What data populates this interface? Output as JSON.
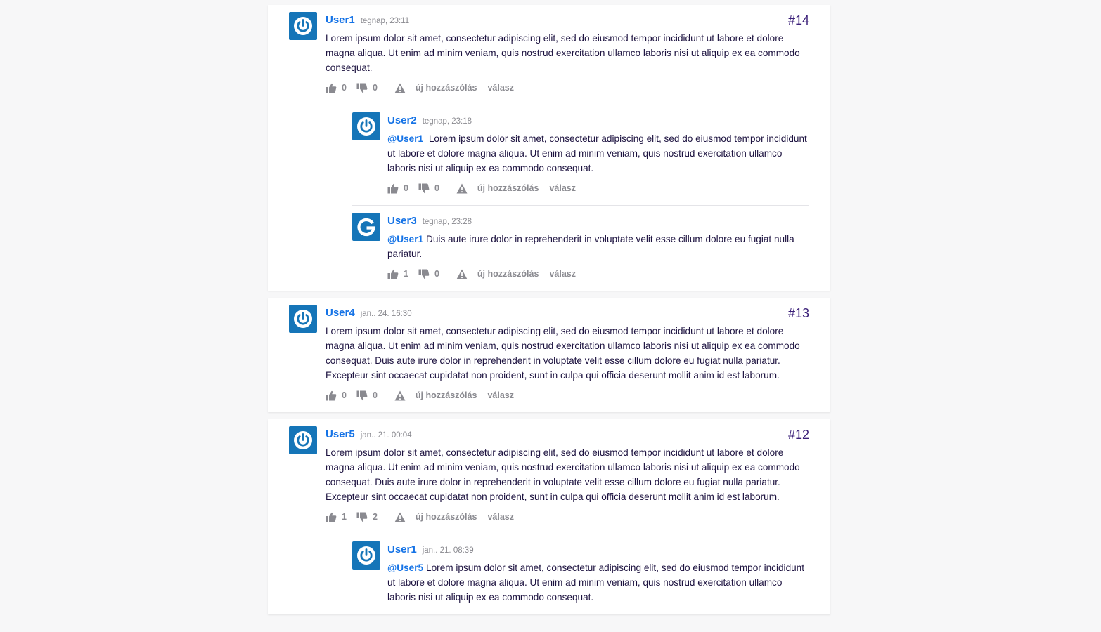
{
  "actions": {
    "new_post": "új hozzászólás",
    "reply": "válasz"
  },
  "threads": [
    {
      "number": "#14",
      "comment": {
        "user": "User1",
        "time": "tegnap, 23:11",
        "text": "Lorem ipsum dolor sit amet, consectetur adipiscing elit, sed do eiusmod tempor incididunt ut labore et dolore magna aliqua. Ut enim ad minim veniam, quis nostrud exercitation ullamco laboris nisi ut aliquip ex ea commodo consequat.",
        "likes": "0",
        "dislikes": "0",
        "avatar_icon": "power-icon"
      },
      "replies": [
        {
          "user": "User2",
          "time": "tegnap, 23:18",
          "mention": "@User1",
          "text": "Lorem ipsum dolor sit amet, consectetur adipiscing elit, sed do eiusmod tempor incididunt ut labore et dolore magna aliqua. Ut enim ad minim veniam, quis nostrud exercitation ullamco laboris nisi ut aliquip ex ea commodo consequat.",
          "likes": "0",
          "dislikes": "0",
          "avatar_icon": "power-icon"
        },
        {
          "user": "User3",
          "time": "tegnap, 23:28",
          "mention": "@User1",
          "text": "Duis aute irure dolor in reprehenderit in voluptate velit esse cillum dolore eu fugiat nulla pariatur.",
          "likes": "1",
          "dislikes": "0",
          "avatar_icon": "google-icon"
        }
      ]
    },
    {
      "number": "#13",
      "comment": {
        "user": "User4",
        "time": "jan.. 24. 16:30",
        "text": "Lorem ipsum dolor sit amet, consectetur adipiscing elit, sed do eiusmod tempor incididunt ut labore et dolore magna aliqua. Ut enim ad minim veniam, quis nostrud exercitation ullamco laboris nisi ut aliquip ex ea commodo consequat. Duis aute irure dolor in reprehenderit in voluptate velit esse cillum dolore eu fugiat nulla pariatur. Excepteur sint occaecat cupidatat non proident, sunt in culpa qui officia deserunt mollit anim id est laborum.",
        "likes": "0",
        "dislikes": "0",
        "avatar_icon": "power-icon"
      }
    },
    {
      "number": "#12",
      "comment": {
        "user": "User5",
        "time": "jan.. 21. 00:04",
        "text": "Lorem ipsum dolor sit amet, consectetur adipiscing elit, sed do eiusmod tempor incididunt ut labore et dolore magna aliqua. Ut enim ad minim veniam, quis nostrud exercitation ullamco laboris nisi ut aliquip ex ea commodo consequat. Duis aute irure dolor in reprehenderit in voluptate velit esse cillum dolore eu fugiat nulla pariatur. Excepteur sint occaecat cupidatat non proident, sunt in culpa qui officia deserunt mollit anim id est laborum.",
        "likes": "1",
        "dislikes": "2",
        "avatar_icon": "power-icon"
      },
      "replies": [
        {
          "user": "User1",
          "time": "jan.. 21. 08:39",
          "mention": "@User5",
          "text": "Lorem ipsum dolor sit amet, consectetur adipiscing elit, sed do eiusmod tempor incididunt ut labore et dolore magna aliqua. Ut enim ad minim veniam, quis nostrud exercitation ullamco laboris nisi ut aliquip ex ea commodo consequat.",
          "avatar_icon": "power-icon"
        }
      ]
    }
  ]
}
